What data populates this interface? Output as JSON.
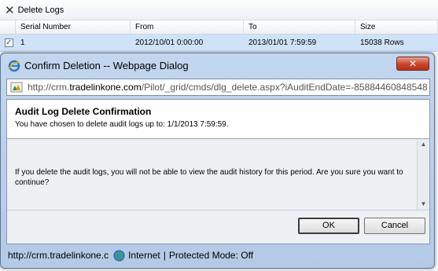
{
  "toolbar": {
    "delete_label": "Delete Logs"
  },
  "grid": {
    "columns": [
      "Serial Number",
      "From",
      "To",
      "Size"
    ],
    "row": {
      "serial": "1",
      "from": "2012/10/01 0:00:00",
      "to": "2013/01/01 7:59:59",
      "size": "15038 Rows",
      "checked": "✓"
    }
  },
  "dialog": {
    "title": "Confirm Deletion -- Webpage Dialog",
    "close_label": "✕",
    "address": {
      "prefix": "http://crm.",
      "domain": "tradelinkone.com",
      "path": "/Pilot/_grid/cmds/dlg_delete.aspx?iAuditEndDate=-85884460848548"
    },
    "header": {
      "title": "Audit Log Delete Confirmation",
      "description": "You have chosen to delete audit logs up to: 1/1/2013 7:59:59."
    },
    "body_text": "If you delete the audit logs, you will not be able to view the audit history for this period. Are you sure you want to continue?",
    "ok_label": "OK",
    "cancel_label": "Cancel",
    "status": {
      "url": "http://crm.tradelinkone.c",
      "zone": "Internet",
      "separator": "|",
      "mode": "Protected Mode: Off"
    }
  },
  "colors": {
    "selection": "#cfe2f7",
    "close_button": "#c8432b",
    "frame": "#b3c9e6"
  }
}
